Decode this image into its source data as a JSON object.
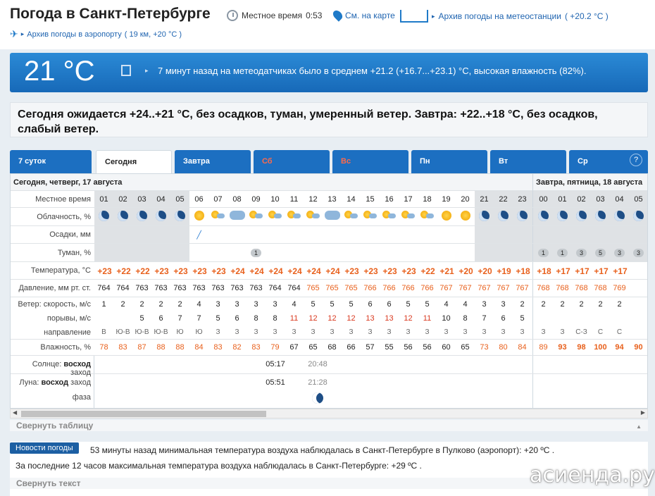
{
  "header": {
    "title": "Погода в Санкт-Петербурге",
    "local_time_label": "Местное время",
    "local_time": "0:53",
    "map_link": "См. на карте",
    "archive_station": "Архив погоды на метеостанции",
    "archive_station_temp": "( +20.2 °C )",
    "archive_airport": "Архив погоды в аэропорту",
    "archive_airport_info": "( 19 км, +20 °C )"
  },
  "current": {
    "temp": "21 °C",
    "description": "7 минут назад на метеодатчиках было в среднем +21.2 (+16.7...+23.1) °C, высокая влажность (82%)."
  },
  "forecast_text": "Сегодня ожидается +24..+21 °C, без осадков, туман, умеренный ветер. Завтра: +22..+18 °C, без осадков, слабый ветер.",
  "tabs": [
    {
      "label": "7 суток"
    },
    {
      "label": "Сегодня"
    },
    {
      "label": "Завтра"
    },
    {
      "label": "Сб"
    },
    {
      "label": "Вс"
    },
    {
      "label": "Пн"
    },
    {
      "label": "Вт"
    },
    {
      "label": "Ср"
    }
  ],
  "help_label": "?",
  "days": {
    "today": "Сегодня, четверг, 17 августа",
    "tomorrow": "Завтра, пятница, 18 августа"
  },
  "row_labels": {
    "time": "Местное время",
    "cloud": "Облачность, %",
    "precip": "Осадки, мм",
    "fog": "Туман, %",
    "temp": "Температура, °C",
    "pressure": "Давление, мм рт. ст.",
    "wind_speed": "Ветер: скорость, м/с",
    "gusts": "порывы, м/с",
    "direction": "направление",
    "humidity": "Влажность, %",
    "sun_a": "Солнце:",
    "sun_b": "восход",
    "sun_c": "заход",
    "moon_a": "Луна:",
    "moon_b": "восход",
    "moon_c": "заход",
    "phase": "фаза"
  },
  "hours": [
    "01",
    "02",
    "03",
    "04",
    "05",
    "06",
    "07",
    "08",
    "09",
    "10",
    "11",
    "12",
    "13",
    "14",
    "15",
    "16",
    "17",
    "18",
    "19",
    "20",
    "21",
    "22",
    "23",
    "00",
    "01",
    "02",
    "03",
    "04",
    "05"
  ],
  "clouds": [
    "moon-cloud",
    "moon-cloud",
    "moon-cloud",
    "moon-cloud",
    "moon-cloud",
    "sun",
    "sun-cloud",
    "clouds",
    "sun-cloud",
    "sun-cloud",
    "sun-cloud",
    "sun-cloud",
    "clouds",
    "sun-cloud",
    "sun-cloud",
    "sun-cloud",
    "sun-cloud",
    "sun-cloud",
    "sun",
    "sun",
    "moon-cloud",
    "moon-cloud",
    "moon-cloud",
    "moon",
    "moon",
    "moon",
    "moon",
    "moon",
    "moon"
  ],
  "precip": [
    "",
    "",
    "",
    "",
    "",
    "drop",
    "",
    "",
    "",
    "",
    "",
    "",
    "",
    "",
    "",
    "",
    "",
    "",
    "",
    "",
    "",
    "",
    "",
    "",
    "",
    "",
    "",
    "",
    ""
  ],
  "fog": [
    "",
    "",
    "",
    "",
    "",
    "",
    "",
    "",
    "1",
    "",
    "",
    "",
    "",
    "",
    "",
    "",
    "",
    "",
    "",
    "",
    "",
    "",
    "",
    "1",
    "1",
    "3",
    "5",
    "3",
    "3"
  ],
  "temps": [
    "+23",
    "+22",
    "+22",
    "+23",
    "+23",
    "+23",
    "+23",
    "+24",
    "+24",
    "+24",
    "+24",
    "+24",
    "+24",
    "+23",
    "+23",
    "+23",
    "+23",
    "+22",
    "+21",
    "+20",
    "+20",
    "+19",
    "+18",
    "+18",
    "+17",
    "+17",
    "+17",
    "+17",
    ""
  ],
  "pressure": [
    "764",
    "764",
    "763",
    "763",
    "763",
    "763",
    "763",
    "763",
    "763",
    "764",
    "764",
    "765",
    "765",
    "765",
    "766",
    "766",
    "766",
    "766",
    "767",
    "767",
    "767",
    "767",
    "767",
    "768",
    "768",
    "768",
    "768",
    "769",
    ""
  ],
  "wind": [
    "1",
    "2",
    "2",
    "2",
    "2",
    "4",
    "3",
    "3",
    "3",
    "3",
    "4",
    "5",
    "5",
    "5",
    "6",
    "6",
    "5",
    "5",
    "4",
    "4",
    "3",
    "3",
    "2",
    "2",
    "2",
    "2",
    "2",
    "2",
    ""
  ],
  "gusts": [
    "",
    "",
    "5",
    "6",
    "7",
    "7",
    "5",
    "6",
    "8",
    "8",
    "11",
    "12",
    "12",
    "12",
    "13",
    "13",
    "12",
    "11",
    "10",
    "8",
    "7",
    "6",
    "5",
    "",
    "",
    "",
    "",
    "",
    ""
  ],
  "direction": [
    "В",
    "Ю-В",
    "Ю-В",
    "Ю-В",
    "Ю",
    "Ю",
    "З",
    "З",
    "З",
    "З",
    "З",
    "З",
    "З",
    "З",
    "З",
    "З",
    "З",
    "З",
    "З",
    "З",
    "З",
    "З",
    "З",
    "З",
    "З",
    "С-З",
    "С",
    "С",
    ""
  ],
  "humidity": [
    "78",
    "83",
    "87",
    "88",
    "88",
    "84",
    "83",
    "82",
    "83",
    "79",
    "67",
    "65",
    "68",
    "66",
    "57",
    "55",
    "56",
    "56",
    "60",
    "65",
    "73",
    "80",
    "84",
    "89",
    "93",
    "98",
    "100",
    "94",
    "90"
  ],
  "sun": {
    "rise": "05:17",
    "set": "20:48"
  },
  "moon": {
    "rise": "05:51",
    "set": "21:28"
  },
  "collapse_table": "Свернуть таблицу",
  "news": {
    "badge": "Новости погоды",
    "line1": "53 минуты назад минимальная температура воздуха наблюдалась в Санкт-Петербурге в Пулково (аэропорт): +20 ºC .",
    "line2": "За последние 12 часов максимальная температура воздуха наблюдалась в Санкт-Петербурге: +29 ºC .",
    "collapse": "Свернуть текст"
  },
  "watermark": "асиенда.ру",
  "colors": {
    "accent": "#1c6fc1",
    "warm": "#e8601c",
    "night": "#dfe2e5"
  }
}
